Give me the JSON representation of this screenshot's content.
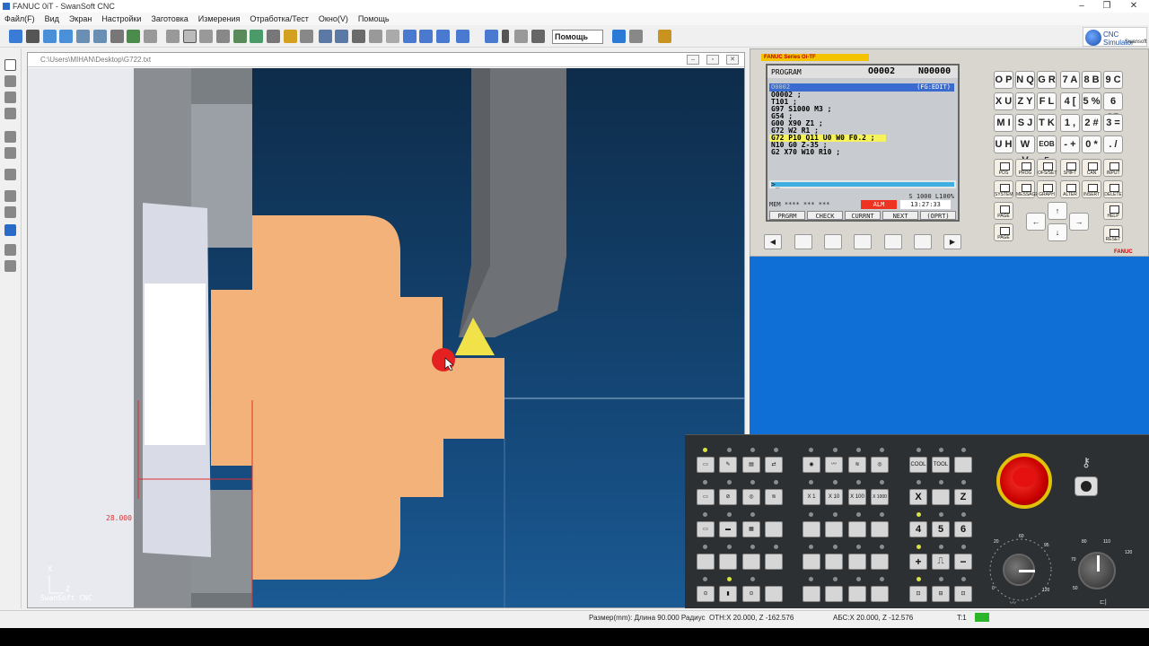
{
  "window": {
    "title": "FANUC 0iT - SwanSoft CNC"
  },
  "menu": {
    "items": [
      "Файл(F)",
      "Вид",
      "Экран",
      "Настройки",
      "Заготовка",
      "Измерения",
      "Отработка/Тест",
      "Окно(V)",
      "Помощь"
    ]
  },
  "toolbar": {
    "help_select": "Помощь"
  },
  "logo": {
    "name": "CNC Simulator",
    "vendor": "Swansoft"
  },
  "view": {
    "path": "C:\\Users\\MIHAN\\Desktop\\G722.txt",
    "dimension_label": "28.000",
    "axis_x": "X",
    "axis_z": "Z",
    "watermark": "SwanSoft CNC"
  },
  "fanuc": {
    "series": "FANUC Series Oi-TF",
    "program_label": "PROGRAM",
    "program_number": "O0002",
    "sequence_number": "N00000",
    "sub_left": "O0002",
    "sub_right": "(FG:EDIT)",
    "code_lines": [
      "O0002 ;",
      "T101 ;",
      "G97 S1000 M3 ;",
      "G54 ;",
      "G00 X90 Z1 ;",
      "G72 W2 R1 ;",
      "G72 P10 Q11 U0 W0 F0.2 ;",
      "N10 G0 Z-35 ;",
      "G2 X70 W10 R10 ;"
    ],
    "prompt": ">_",
    "status_info": "S 1000 L100%",
    "mode": "MEM **** ***   ***",
    "alarm": "ALM",
    "time": "13:27:33",
    "softkeys": [
      "PRGRM",
      "CHECK",
      "CURRNT",
      "NEXT",
      "(OPRT)"
    ],
    "brand": "FANUC"
  },
  "keypad": {
    "row1": [
      "O P",
      "N Q",
      "G R",
      "7 A",
      "8 B",
      "9 C"
    ],
    "row2": [
      "X U",
      "Z Y",
      "F L",
      "4 [",
      "5 %",
      "6 SP"
    ],
    "row3": [
      "M I",
      "S J",
      "T K",
      "1 ,",
      "2 #",
      "3 ="
    ],
    "row4": [
      "U H",
      "W V",
      "EOB E",
      "- +",
      "0 *",
      ". /"
    ],
    "fn1": [
      "POS",
      "PROG",
      "OFS/SET",
      "SHIFT",
      "CAN",
      "INPUT"
    ],
    "fn2": [
      "SYSTEM",
      "MESSAGE",
      "GRAPH",
      "ALTER",
      "INSERT",
      "DELETE"
    ],
    "page_up": "PAGE",
    "page_down": "PAGE",
    "help": "HELP",
    "reset": "RESET"
  },
  "operator_panel": {
    "mult": [
      "X 1",
      "X 10",
      "X 100",
      "X 1000"
    ],
    "cool": "COOL",
    "tool": "TOOL",
    "axis_x": "X",
    "axis_z": "Z",
    "num": [
      "4",
      "5",
      "6"
    ],
    "plus": "+",
    "minus": "−",
    "feed_scale": [
      "0",
      "2",
      "4",
      "6",
      "8",
      "10",
      "15",
      "20",
      "30",
      "40",
      "50",
      "60",
      "70",
      "80",
      "90",
      "95",
      "100",
      "105",
      "110",
      "120"
    ],
    "spindle_scale": [
      "50",
      "60",
      "70",
      "80",
      "90",
      "100",
      "110",
      "120"
    ]
  },
  "status": {
    "size": "Размер(mm): Длина  90.000 Радиус",
    "rel": "ОТН:X  20.000, Z -162.576",
    "abs": "АБС:X  20.000, Z  -12.576",
    "tool": "T:1"
  }
}
